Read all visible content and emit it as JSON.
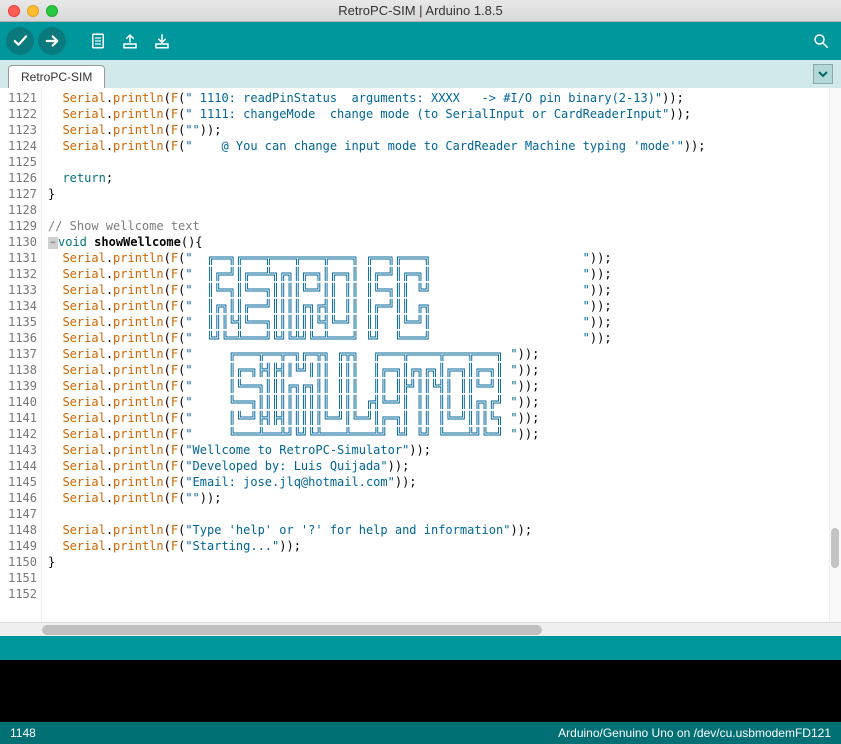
{
  "window": {
    "title": "RetroPC-SIM | Arduino 1.8.5"
  },
  "tab": {
    "name": "RetroPC-SIM"
  },
  "footer": {
    "line": "1148",
    "board": "Arduino/Genuino Uno on /dev/cu.usbmodemFD121"
  },
  "gutter_start": 1121,
  "gutter_end": 1152,
  "code_lines": [
    {
      "n": 1121,
      "pre": "  ",
      "obj": "Serial",
      "dot": ".",
      "fn": "println",
      "open": "(",
      "f": "F",
      "po": "(",
      "str": "\" 1110: readPinStatus  arguments: XXXX   -> #I/O pin binary(2-13)\"",
      "close": "));"
    },
    {
      "n": 1122,
      "pre": "  ",
      "obj": "Serial",
      "dot": ".",
      "fn": "println",
      "open": "(",
      "f": "F",
      "po": "(",
      "str": "\" 1111: changeMode  change mode (to SerialInput or CardReaderInput\"",
      "close": "));"
    },
    {
      "n": 1123,
      "pre": "  ",
      "obj": "Serial",
      "dot": ".",
      "fn": "println",
      "open": "(",
      "f": "F",
      "po": "(",
      "str": "\"\"",
      "close": "));"
    },
    {
      "n": 1124,
      "pre": "  ",
      "obj": "Serial",
      "dot": ".",
      "fn": "println",
      "open": "(",
      "f": "F",
      "po": "(",
      "str": "\"    @ You can change input mode to CardReader Machine typing 'mode'\"",
      "close": "));"
    },
    {
      "n": 1125,
      "raw": ""
    },
    {
      "n": 1126,
      "pre": "  ",
      "kw": "return",
      "post": ";"
    },
    {
      "n": 1127,
      "raw": "}"
    },
    {
      "n": 1128,
      "raw": ""
    },
    {
      "n": 1129,
      "cmt": "// Show wellcome text"
    },
    {
      "n": 1130,
      "fold": true,
      "td": "void",
      "sp": " ",
      "name": "showWellcome",
      "sig": "(){"
    },
    {
      "n": 1131,
      "pre": "  ",
      "obj": "Serial",
      "dot": ".",
      "fn": "println",
      "open": "(",
      "f": "F",
      "po": "(",
      "str": "\"  ╔══╗╔═══╦═══╦═══╦═══╗ ╔══╗╔═══╗                     \"",
      "close": "));"
    },
    {
      "n": 1132,
      "pre": "  ",
      "obj": "Serial",
      "dot": ".",
      "fn": "println",
      "open": "(",
      "f": "F",
      "po": "(",
      "str": "\"  ║╔═╝║╔══╩╗╔╗║╔═╗║╔═╗║ ║╔═╝║╔═╗║                     \"",
      "close": "));"
    },
    {
      "n": 1133,
      "pre": "  ",
      "obj": "Serial",
      "dot": ".",
      "fn": "println",
      "open": "(",
      "f": "F",
      "po": "(",
      "str": "\"  ║╚═╗║╚══╗║║║║╚═╝║║ ║║ ║╚═╗║║ ╚╝                     \"",
      "close": "));"
    },
    {
      "n": 1134,
      "pre": "  ",
      "obj": "Serial",
      "dot": ".",
      "fn": "println",
      "open": "(",
      "f": "F",
      "po": "(",
      "str": "\"  ║╔╗║║╔══╝║║║║╔╗╔╣║ ║║ ║╔═╝║║ ╔╗                     \"",
      "close": "));"
    },
    {
      "n": 1135,
      "pre": "  ",
      "obj": "Serial",
      "dot": ".",
      "fn": "println",
      "open": "(",
      "f": "F",
      "po": "(",
      "str": "\"  ║║║╚╣╚══╗║║║║║║╚╣╚═╝║ ║║  ║╚═╝║                     \"",
      "close": "));"
    },
    {
      "n": 1136,
      "pre": "  ",
      "obj": "Serial",
      "dot": ".",
      "fn": "println",
      "open": "(",
      "f": "F",
      "po": "(",
      "str": "\"  ╚╝╚═╩═══╝╚╝╚╩╝╚═╩═══╝ ╚╝  ╚═══╝                     \"",
      "close": "));"
    },
    {
      "n": 1137,
      "pre": "  ",
      "obj": "Serial",
      "dot": ".",
      "fn": "println",
      "open": "(",
      "f": "F",
      "po": "(",
      "str": "\"     ╔═══╦══╦═╗╔═╦╗ ╔╦╗  ╔═══╦════╦═══╦═══╗ \"",
      "close": "));"
    },
    {
      "n": 1138,
      "pre": "  ",
      "obj": "Serial",
      "dot": ".",
      "fn": "println",
      "open": "(",
      "f": "F",
      "po": "(",
      "str": "\"     ║╔═╗╠╣╠╣║╚╝║║║ ║║║  ║╔═╗║╔╗╔╗║╔═╗║╔═╗║ \"",
      "close": "));"
    },
    {
      "n": 1139,
      "pre": "  ",
      "obj": "Serial",
      "dot": ".",
      "fn": "println",
      "open": "(",
      "f": "F",
      "po": "(",
      "str": "\"     ║╚══╗║║║╔╗╔╗║║ ║║║  ║║ ║╠╝║║╚╣║ ║║╚═╝║ \"",
      "close": "));"
    },
    {
      "n": 1140,
      "pre": "  ",
      "obj": "Serial",
      "dot": ".",
      "fn": "println",
      "open": "(",
      "f": "F",
      "po": "(",
      "str": "\"     ╚══╗║║║║║║║║║║ ║║║ ╔╣╚═╝║ ║║ ║║ ║║╔╗╔╝ \"",
      "close": "));"
    },
    {
      "n": 1141,
      "pre": "  ",
      "obj": "Serial",
      "dot": ".",
      "fn": "println",
      "open": "(",
      "f": "F",
      "po": "(",
      "str": "\"     ║╚═╝╠╣╠╣║║║║║╚═╝║╚═╝║╔═╗║ ║║ ║╚═╝║║║╚╗ \"",
      "close": "));"
    },
    {
      "n": 1142,
      "pre": "  ",
      "obj": "Serial",
      "dot": ".",
      "fn": "println",
      "open": "(",
      "f": "F",
      "po": "(",
      "str": "\"     ╚═══╩══╩╝╚╝╚╩═══╩═══╩╝ ╚╝ ╚╝ ╚═══╩╝╚═╝ \"",
      "close": "));"
    },
    {
      "n": 1143,
      "pre": "  ",
      "obj": "Serial",
      "dot": ".",
      "fn": "println",
      "open": "(",
      "f": "F",
      "po": "(",
      "str": "\"Wellcome to RetroPC-Simulator\"",
      "close": "));"
    },
    {
      "n": 1144,
      "pre": "  ",
      "obj": "Serial",
      "dot": ".",
      "fn": "println",
      "open": "(",
      "f": "F",
      "po": "(",
      "str": "\"Developed by: Luis Quijada\"",
      "close": "));"
    },
    {
      "n": 1145,
      "pre": "  ",
      "obj": "Serial",
      "dot": ".",
      "fn": "println",
      "open": "(",
      "f": "F",
      "po": "(",
      "str": "\"Email: jose.jlq@hotmail.com\"",
      "close": "));"
    },
    {
      "n": 1146,
      "pre": "  ",
      "obj": "Serial",
      "dot": ".",
      "fn": "println",
      "open": "(",
      "f": "F",
      "po": "(",
      "str": "\"\"",
      "close": "));"
    },
    {
      "n": 1147,
      "raw": ""
    },
    {
      "n": 1148,
      "pre": "  ",
      "obj": "Serial",
      "dot": ".",
      "fn": "println",
      "open": "(",
      "f": "F",
      "po": "(",
      "str": "\"Type 'help' or '?' for help and information\"",
      "close": "));"
    },
    {
      "n": 1149,
      "pre": "  ",
      "obj": "Serial",
      "dot": ".",
      "fn": "println",
      "open": "(",
      "f": "F",
      "po": "(",
      "str": "\"Starting...\"",
      "close": "));"
    },
    {
      "n": 1150,
      "raw": "}"
    },
    {
      "n": 1151,
      "raw": ""
    },
    {
      "n": 1152,
      "raw": ""
    }
  ]
}
